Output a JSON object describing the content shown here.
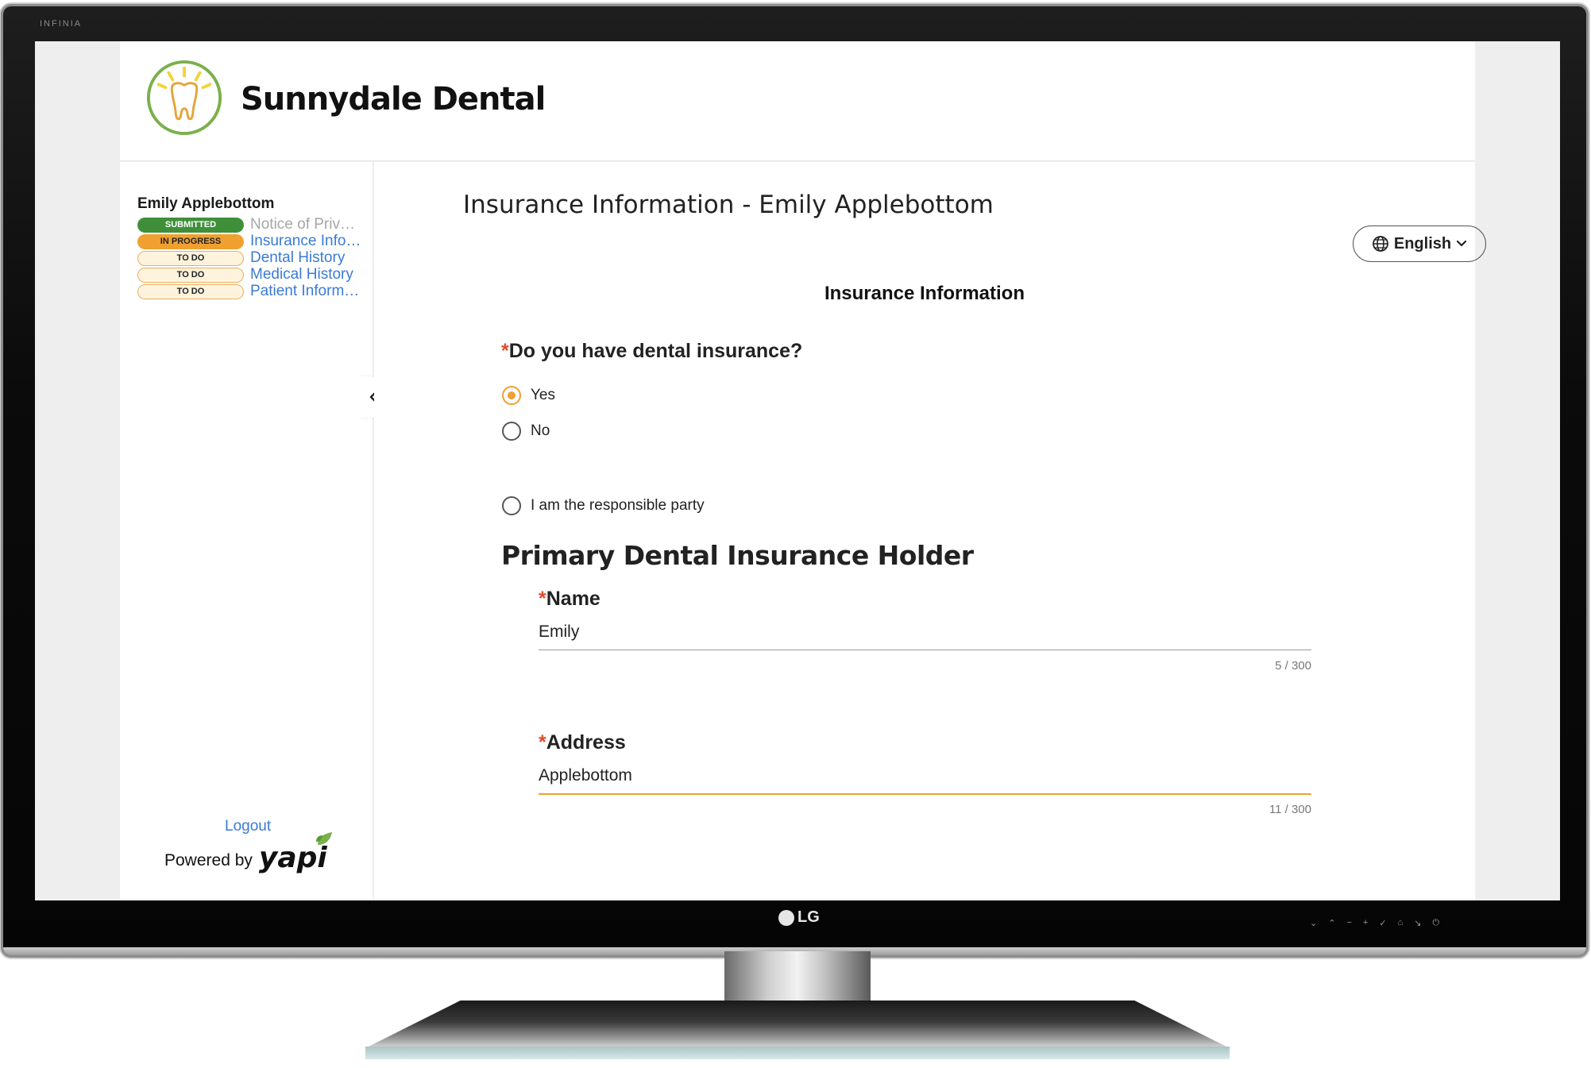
{
  "tv": {
    "brand": "INFINIA",
    "logo": "LG"
  },
  "header": {
    "brand_name": "Sunnydale Dental",
    "logo_icon": "tooth-sun-logo"
  },
  "sidebar": {
    "user_name": "Emily Applebottom",
    "steps": [
      {
        "status": "SUBMITTED",
        "label": "Notice of Privacy Practices",
        "state": "submitted"
      },
      {
        "status": "IN PROGRESS",
        "label": "Insurance Information",
        "state": "in-progress"
      },
      {
        "status": "TO DO",
        "label": "Dental History",
        "state": "todo"
      },
      {
        "status": "TO DO",
        "label": "Medical History",
        "state": "todo"
      },
      {
        "status": "TO DO",
        "label": "Patient Information",
        "state": "todo"
      }
    ],
    "logout_label": "Logout",
    "powered_by": "Powered by",
    "powered_brand": "yapi"
  },
  "main": {
    "page_title": "Insurance Information - Emily Applebottom",
    "language": "English",
    "section_title": "Insurance Information",
    "question": {
      "required_mark": "*",
      "label": "Do you have dental insurance?",
      "options": [
        {
          "label": "Yes",
          "selected": true
        },
        {
          "label": "No",
          "selected": false
        }
      ]
    },
    "responsible_party_label": "I am the responsible party",
    "holder_title": "Primary Dental Insurance Holder",
    "fields": {
      "name": {
        "required_mark": "*",
        "label": "Name",
        "value": "Emily",
        "counter": "5 / 300"
      },
      "address": {
        "required_mark": "*",
        "label": "Address",
        "value": "Applebottom",
        "counter": "11 / 300"
      }
    }
  },
  "colors": {
    "accent": "#f0a030",
    "submitted": "#3f8f3a",
    "link": "#3a7bd5",
    "required": "#e04b2a"
  }
}
